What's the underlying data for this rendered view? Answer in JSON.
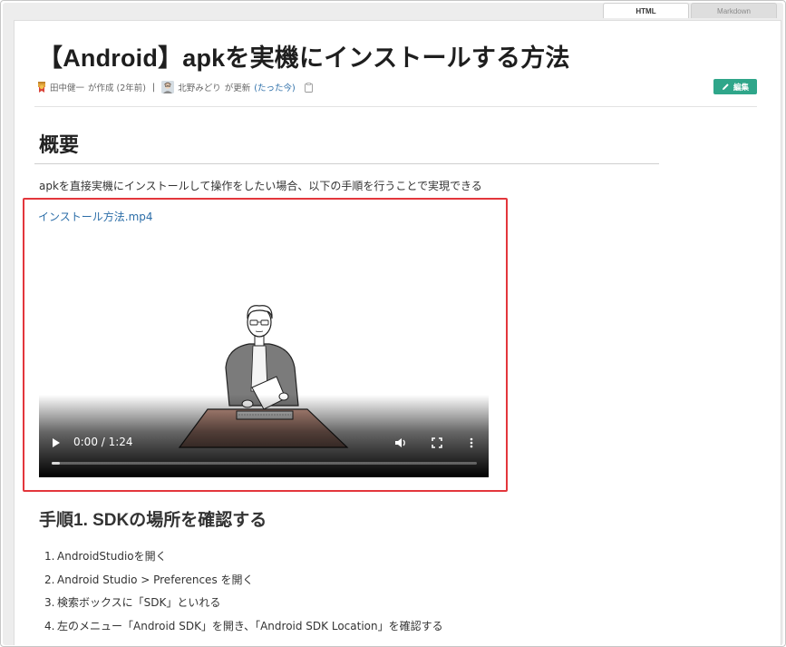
{
  "tabs": {
    "html_label": "HTML",
    "markdown_label": "Markdown"
  },
  "page": {
    "title": "【Android】apkを実機にインストールする方法",
    "meta": {
      "author": "田中健一",
      "created_text": "が作成 (2年前)",
      "separator": "|",
      "updater": "北野みどり",
      "updated_text": "が更新",
      "updated_link": "(たった今)"
    },
    "edit_label": "編集"
  },
  "section_overview": {
    "heading": "概要",
    "paragraph": "apkを直接実機にインストールして操作をしたい場合、以下の手順を行うことで実現できる",
    "video_link": "インストール方法.mp4",
    "video": {
      "time": "0:00 / 1:24",
      "progress": 0.02
    }
  },
  "section_step1": {
    "heading": "手順1. SDKの場所を確認する",
    "steps": [
      {
        "num": "1.",
        "text": "AndroidStudioを開く"
      },
      {
        "num": "2.",
        "text": "Android Studio > Preferences を開く"
      },
      {
        "num": "3.",
        "text": "検索ボックスに「SDK」といれる"
      },
      {
        "num": "4.",
        "text": "左のメニュー「Android SDK」を開き、「Android SDK Location」を確認する"
      }
    ]
  },
  "colors": {
    "accent_green": "#2fa68a",
    "link_blue": "#2c6ea8",
    "highlight_red": "#e3363c"
  },
  "icons": {
    "author_badge": "award-ribbon-icon",
    "updater_avatar": "avatar",
    "clipboard": "clipboard-icon",
    "edit": "pencil-icon",
    "play": "play-icon",
    "volume": "volume-icon",
    "fullscreen": "fullscreen-icon",
    "more": "more-vertical-icon"
  }
}
